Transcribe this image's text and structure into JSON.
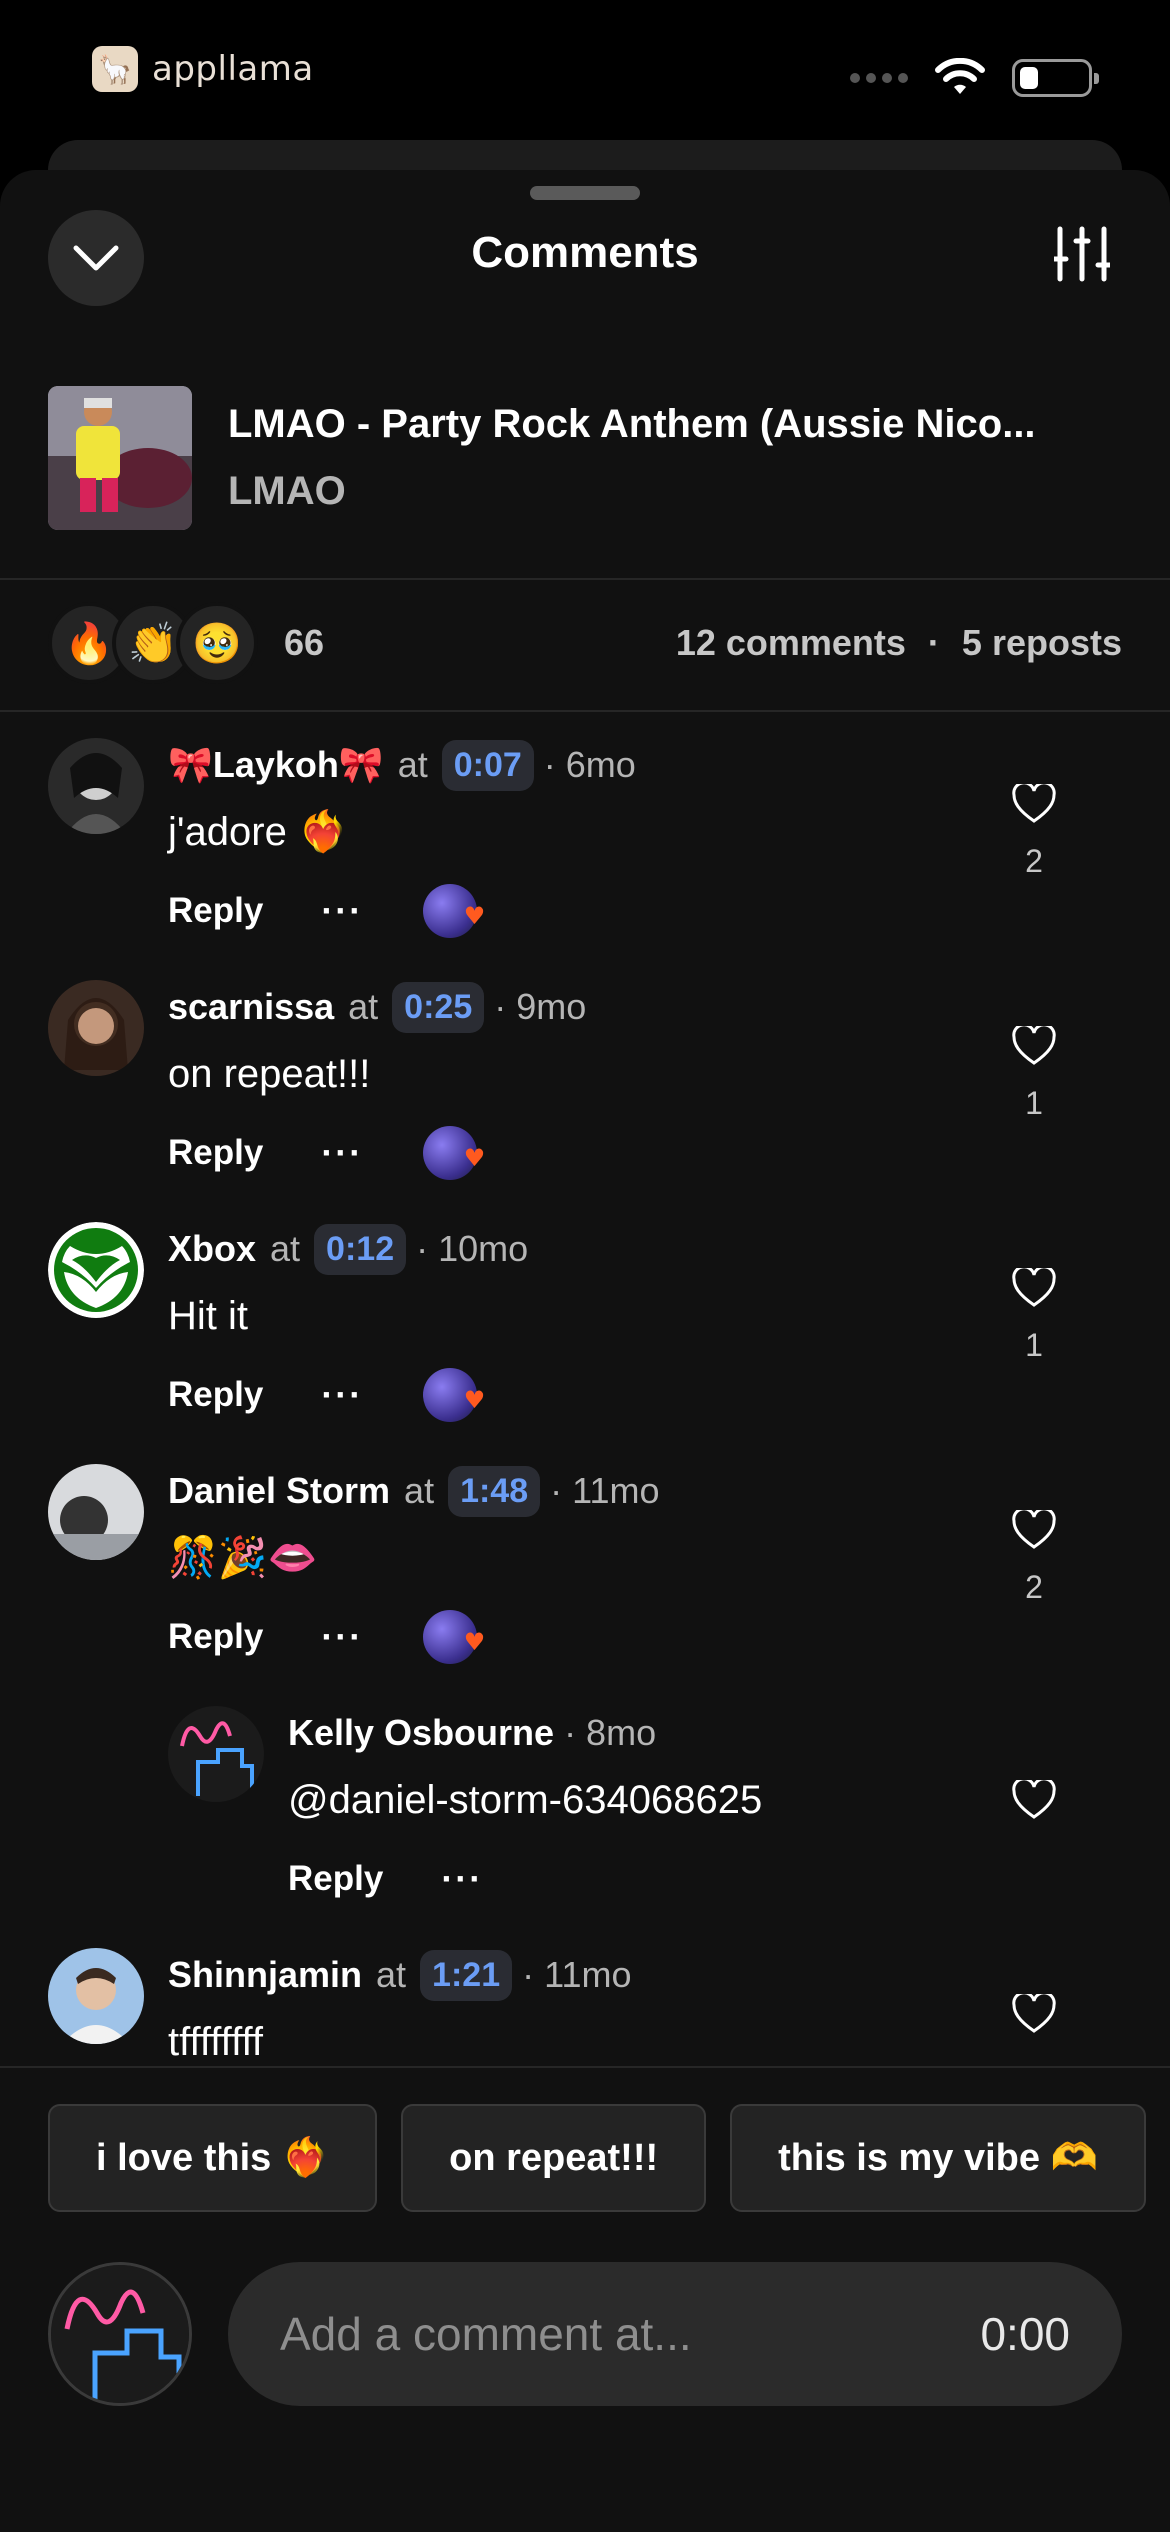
{
  "status_bar": {
    "app_name": "appllama"
  },
  "sheet": {
    "title": "Comments"
  },
  "track": {
    "title": "LMAO - Party Rock Anthem (Aussie Nico...",
    "artist": "LMAO"
  },
  "stats": {
    "reactions": [
      "🔥",
      "👏",
      "🥹"
    ],
    "reaction_count": "66",
    "comments": "12 comments",
    "separator": "·",
    "reposts": "5 reposts"
  },
  "comments": [
    {
      "user": "🎀Laykoh🎀",
      "at": "at",
      "timestamp": "0:07",
      "age": "· 6mo",
      "text": "j'adore ❤️‍🔥",
      "reply": "Reply",
      "more": "···",
      "likes": "2"
    },
    {
      "user": "scarnissa",
      "at": "at",
      "timestamp": "0:25",
      "age": "· 9mo",
      "text": "on repeat!!!",
      "reply": "Reply",
      "more": "···",
      "likes": "1"
    },
    {
      "user": "Xbox",
      "at": "at",
      "timestamp": "0:12",
      "age": "· 10mo",
      "text": "Hit it",
      "reply": "Reply",
      "more": "···",
      "likes": "1"
    },
    {
      "user": "Daniel Storm",
      "at": "at",
      "timestamp": "1:48",
      "age": "· 11mo",
      "text": "🎊🎉👄",
      "reply": "Reply",
      "more": "···",
      "likes": "2"
    },
    {
      "user": "Kelly Osbourne",
      "age": "· 8mo",
      "text": "@daniel-storm-634068625",
      "reply": "Reply",
      "more": "···",
      "likes": ""
    },
    {
      "user": "Shinnjamin",
      "at": "at",
      "timestamp": "1:21",
      "age": "· 11mo",
      "text": "tffffffff",
      "likes": ""
    }
  ],
  "quick_replies": [
    "i love this ❤️‍🔥",
    "on repeat!!!",
    "this is my vibe 🫶"
  ],
  "composer": {
    "placeholder": "Add a comment at...",
    "time": "0:00"
  },
  "colors": {
    "accent_timestamp": "#6b9df5",
    "sheet_bg": "#111111",
    "heart_badge": "#ff5a1f"
  }
}
